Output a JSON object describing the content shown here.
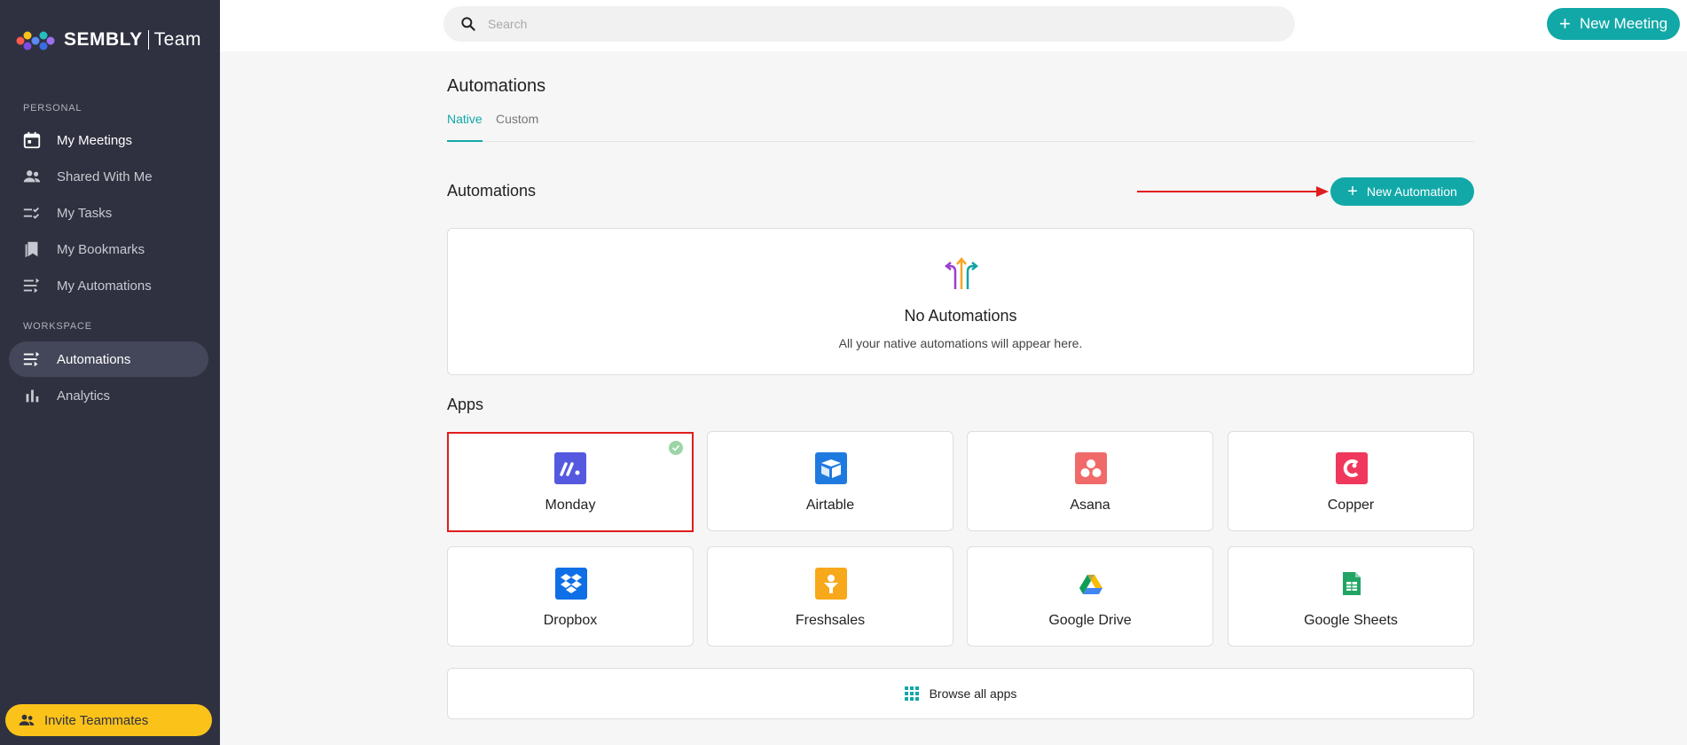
{
  "brand": {
    "name": "SEMBLY",
    "plan": "Team"
  },
  "sidebar": {
    "personal_label": "PERSONAL",
    "workspace_label": "WORKSPACE",
    "personal_items": [
      {
        "label": "My Meetings",
        "icon": "calendar-icon"
      },
      {
        "label": "Shared With Me",
        "icon": "people-icon"
      },
      {
        "label": "My Tasks",
        "icon": "tasks-icon"
      },
      {
        "label": "My Bookmarks",
        "icon": "bookmarks-icon"
      },
      {
        "label": "My Automations",
        "icon": "automations-icon"
      }
    ],
    "workspace_items": [
      {
        "label": "Automations",
        "icon": "automations-icon"
      },
      {
        "label": "Analytics",
        "icon": "bar-chart-icon"
      }
    ],
    "invite_label": "Invite Teammates"
  },
  "topbar": {
    "search_placeholder": "Search",
    "new_meeting_label": "New Meeting"
  },
  "main": {
    "title": "Automations",
    "tabs": [
      {
        "label": "Native"
      },
      {
        "label": "Custom"
      }
    ],
    "automations_section_title": "Automations",
    "new_automation_label": "New Automation",
    "empty_title": "No Automations",
    "empty_subtitle": "All your native automations will appear here.",
    "apps_title": "Apps",
    "apps": [
      {
        "name": "Monday",
        "color": "#5559df",
        "selected": true
      },
      {
        "name": "Airtable",
        "color": "#1f7ae0"
      },
      {
        "name": "Asana",
        "color": "#f06a6a"
      },
      {
        "name": "Copper",
        "color": "#f0385c"
      },
      {
        "name": "Dropbox",
        "color": "#0f6fe6"
      },
      {
        "name": "Freshsales",
        "color": "#f7a81b"
      },
      {
        "name": "Google Drive",
        "color": "#ffffff"
      },
      {
        "name": "Google Sheets",
        "color": "#21a464"
      }
    ],
    "browse_all_label": "Browse all apps"
  },
  "colors": {
    "accent": "#12a8a8",
    "sidebar_bg": "#2f3140",
    "invite": "#fbc21a",
    "highlight": "#e11d1d"
  }
}
